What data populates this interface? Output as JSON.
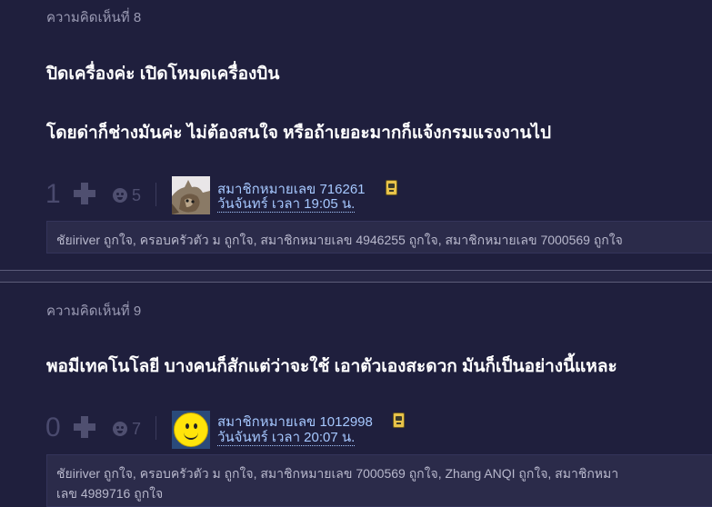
{
  "comments": [
    {
      "number_label": "ความคิดเห็นที่ 8",
      "lines": [
        "ปิดเครื่องค่ะ เปิดโหมดเครื่องบิน",
        "โดยด่าก็ช่างมันค่ะ ไม่ต้องสนใจ หรือถ้าเยอะมากก็แจ้งกรมแรงงานไป"
      ],
      "score": "1",
      "emotion_count": "5",
      "member": "สมาชิกหมายเลข 716261",
      "date": "วันจันทร์ เวลา 19:05 น.",
      "avatar": "cat-photo",
      "likes": "ชัยiriver ถูกใจ, ครอบครัวตัว ม ถูกใจ, สมาชิกหมายเลข 4946255 ถูกใจ, สมาชิกหมายเลข 7000569 ถูกใจ"
    },
    {
      "number_label": "ความคิดเห็นที่ 9",
      "lines": [
        "พอมีเทคโนโลยี บางคนก็สักแต่ว่าจะใช้  เอาตัวเองสะดวก  มันก็เป็นอย่างนี้แหละ"
      ],
      "score": "0",
      "emotion_count": "7",
      "member": "สมาชิกหมายเลข 1012998",
      "date": "วันจันทร์ เวลา 20:07 น.",
      "avatar": "smiley-face",
      "likes_line1": "ชัยiriver ถูกใจ, ครอบครัวตัว ม ถูกใจ, สมาชิกหมายเลข 7000569 ถูกใจ, Zhang ANQI ถูกใจ, สมาชิกหมา",
      "likes_line2": "เลข 4989716 ถูกใจ"
    }
  ],
  "icons": {
    "plus": "plus-icon",
    "emotion": "emotion-icon",
    "badge": "member-badge-icon"
  },
  "colors": {
    "background": "#1f1f3d",
    "link": "#a6c8ff",
    "muted": "#9a9ab3"
  }
}
